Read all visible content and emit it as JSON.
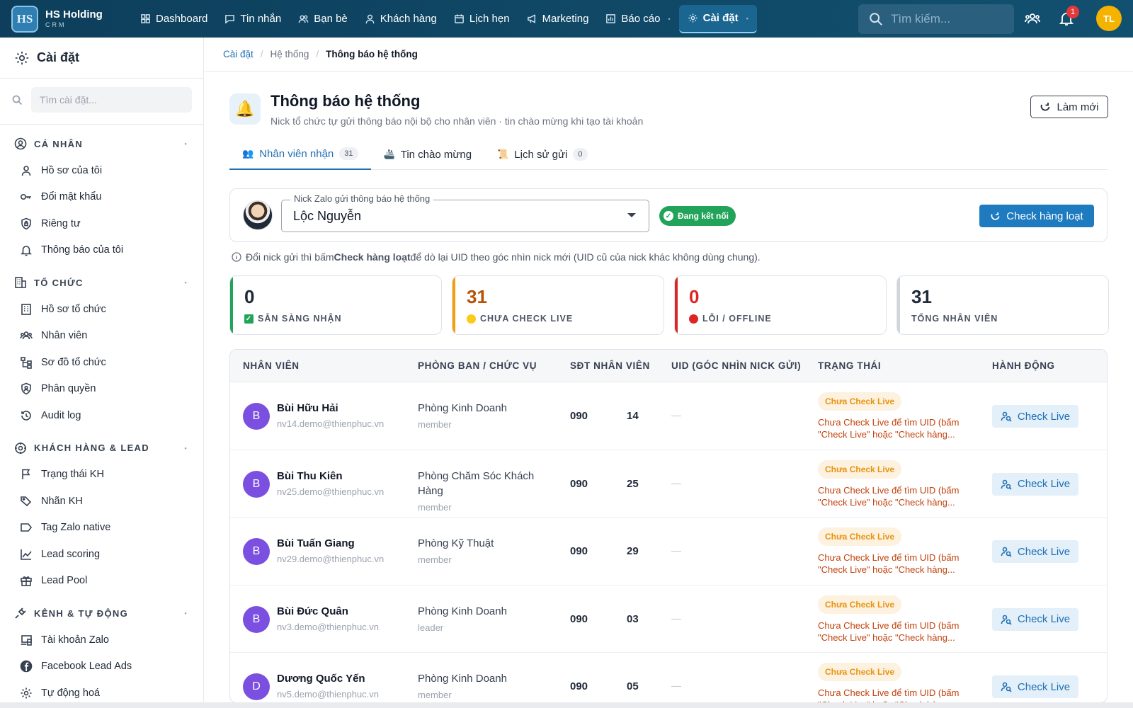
{
  "brand": {
    "name": "HS Holding",
    "sub": "CRM",
    "logo": "HS"
  },
  "nav": [
    {
      "label": "Dashboard",
      "icon": "grid-icon"
    },
    {
      "label": "Tin nhắn",
      "icon": "message-icon"
    },
    {
      "label": "Bạn bè",
      "icon": "friends-icon"
    },
    {
      "label": "Khách hàng",
      "icon": "user-icon"
    },
    {
      "label": "Lịch hẹn",
      "icon": "calendar-icon"
    },
    {
      "label": "Marketing",
      "icon": "megaphone-icon"
    },
    {
      "label": "Báo cáo",
      "icon": "chart-icon"
    },
    {
      "label": "Cài đặt",
      "icon": "gear-icon",
      "active": true
    }
  ],
  "top": {
    "search_placeholder": "Tìm kiếm...",
    "notif_count": "1",
    "avatar": "TL"
  },
  "sidebar": {
    "title": "Cài đặt",
    "search_placeholder": "Tìm cài đặt...",
    "sections": [
      {
        "title": "CÁ NHÂN",
        "items": [
          "Hồ sơ của tôi",
          "Đổi mật khẩu",
          "Riêng tư",
          "Thông báo của tôi"
        ]
      },
      {
        "title": "TỔ CHỨC",
        "items": [
          "Hồ sơ tổ chức",
          "Nhân viên",
          "Sơ đồ tổ chức",
          "Phân quyền",
          "Audit log"
        ]
      },
      {
        "title": "KHÁCH HÀNG & LEAD",
        "items": [
          "Trạng thái KH",
          "Nhãn KH",
          "Tag Zalo native",
          "Lead scoring",
          "Lead Pool"
        ]
      },
      {
        "title": "KÊNH & TỰ ĐỘNG",
        "items": [
          "Tài khoản Zalo",
          "Facebook Lead Ads",
          "Tự động hoá"
        ]
      }
    ]
  },
  "breadcrumb": {
    "c1": "Cài đặt",
    "c2": "Hệ thống",
    "c3": "Thông báo hệ thống"
  },
  "page": {
    "title": "Thông báo hệ thống",
    "subtitle": "Nick tổ chức tự gửi thông báo nội bộ cho nhân viên · tin chào mừng khi tạo tài khoản",
    "refresh": "Làm mới"
  },
  "tabs": [
    {
      "label": "Nhân viên nhận",
      "count": "31"
    },
    {
      "label": "Tin chào mừng",
      "count": ""
    },
    {
      "label": "Lịch sử gửi",
      "count": "0"
    }
  ],
  "zalo": {
    "legend": "Nick Zalo gửi thông báo hệ thống",
    "value": "Lộc Nguyễn",
    "status": "Đang kết nối",
    "bulk": "Check hàng loạt"
  },
  "hint": {
    "pre": "Đổi nick gửi thì bấm",
    "bold": "Check hàng loạt",
    "post": "để dò lại UID theo góc nhìn nick mới (UID cũ của nick khác không dùng chung)."
  },
  "stats": [
    {
      "num": "0",
      "label": "SẴN SÀNG NHẬN",
      "color": "#22a35a"
    },
    {
      "num": "31",
      "label": "CHƯA CHECK LIVE",
      "color": "#f59e0b"
    },
    {
      "num": "0",
      "label": "LỖI / OFFLINE",
      "color": "#dc2626"
    },
    {
      "num": "31",
      "label": "TỔNG NHÂN VIÊN",
      "color": "#d1d5db"
    }
  ],
  "table": {
    "headers": [
      "NHÂN VIÊN",
      "PHÒNG BAN / CHỨC VỤ",
      "SĐT NHÂN VIÊN",
      "UID (GÓC NHÌN NICK GỬI)",
      "TRẠNG THÁI",
      "HÀNH ĐỘNG"
    ],
    "rows": [
      {
        "initial": "B",
        "name": "Bùi Hữu Hải",
        "email": "nv14.demo@thienphuc.vn",
        "dept": "Phòng Kinh Doanh",
        "role": "member",
        "phone_a": "090",
        "phone_b": "14",
        "uid": "—",
        "badge": "Chưa Check Live",
        "status": "Chưa Check Live để tìm UID (bấm \"Check Live\" hoặc \"Check hàng...",
        "action": "Check Live"
      },
      {
        "initial": "B",
        "name": "Bùi Thu Kiên",
        "email": "nv25.demo@thienphuc.vn",
        "dept": "Phòng Chăm Sóc Khách Hàng",
        "role": "member",
        "phone_a": "090",
        "phone_b": "25",
        "uid": "—",
        "badge": "Chưa Check Live",
        "status": "Chưa Check Live để tìm UID (bấm \"Check Live\" hoặc \"Check hàng...",
        "action": "Check Live"
      },
      {
        "initial": "B",
        "name": "Bùi Tuấn Giang",
        "email": "nv29.demo@thienphuc.vn",
        "dept": "Phòng Kỹ Thuật",
        "role": "member",
        "phone_a": "090",
        "phone_b": "29",
        "uid": "—",
        "badge": "Chưa Check Live",
        "status": "Chưa Check Live để tìm UID (bấm \"Check Live\" hoặc \"Check hàng...",
        "action": "Check Live"
      },
      {
        "initial": "B",
        "name": "Bùi Đức Quân",
        "email": "nv3.demo@thienphuc.vn",
        "dept": "Phòng Kinh Doanh",
        "role": "leader",
        "phone_a": "090",
        "phone_b": "03",
        "uid": "—",
        "badge": "Chưa Check Live",
        "status": "Chưa Check Live để tìm UID (bấm \"Check Live\" hoặc \"Check hàng...",
        "action": "Check Live"
      },
      {
        "initial": "D",
        "name": "Dương Quốc Yến",
        "email": "nv5.demo@thienphuc.vn",
        "dept": "Phòng Kinh Doanh",
        "role": "member",
        "phone_a": "090",
        "phone_b": "05",
        "uid": "—",
        "badge": "Chưa Check Live",
        "status": "Chưa Check Live để tìm UID (bấm \"Check Live\" hoặc \"Check hàng...",
        "action": "Check Live"
      }
    ]
  }
}
